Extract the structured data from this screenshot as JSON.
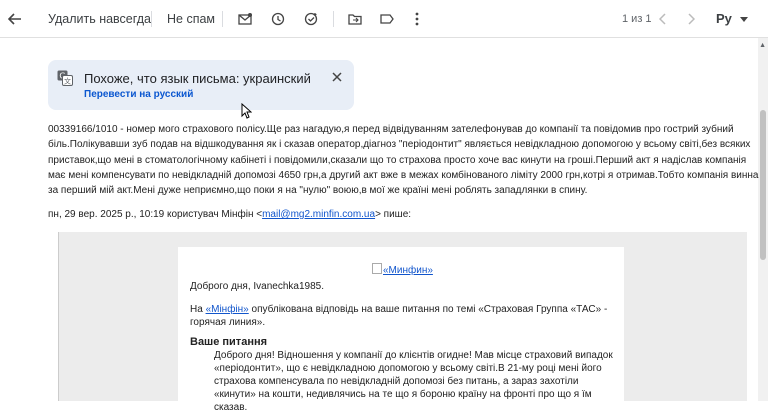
{
  "toolbar": {
    "back_icon": "arrow-left-icon",
    "delete_forever": "Удалить навсегда",
    "not_spam": "Не спам",
    "icons": [
      "mark-unread-icon",
      "snooze-icon",
      "add-task-icon",
      "move-to-icon",
      "label-icon",
      "more-vert-icon"
    ],
    "count": "1 из 1",
    "input_tools": "Ру"
  },
  "translate": {
    "title": "Похоже, что язык письма: украинский",
    "action": "Перевести на русский"
  },
  "message": {
    "body": "00339166/1010 - номер мого страхового полісу.Ще раз нагадую,я перед відвідуванням зателефонував до компанії та повідомив про гострий зубний біль.Полікувавши зуб подав на відшкодування як і сказав оператор,діагноз \"періодонтит\" являється невідкладною допомогою у всьому світі,без всяких приставок,що мені в стоматологічному кабінеті і повідомили,сказали що то страхова просто хоче вас кинути на гроші.Перший акт я надіслав компанія має мені компенсувати по невідкладній допомозі 4650 грн,а другий акт вже в межах комбінованого ліміту 2000 грн,котрі я отримав.Тобто компанія винна за перший мій акт.Мені дуже неприємно,що поки я на \"нулю\" воюю,в мої же країні мені роблять западлянки в спину.",
    "quote_prefix": "пн, 29 вер. 2025 р., 10:19 користувач Мінфін <",
    "quote_email": "mail@mg2.minfin.com.ua",
    "quote_suffix": "> пише:"
  },
  "quoted": {
    "logo_alt": "«Минфин»",
    "greeting": "Доброго дня, Ivanechka1985.",
    "pub_prefix": "На ",
    "pub_link": "«Мінфін»",
    "pub_suffix": " опублікована відповідь на ваше питання по темі «Страховая Группа «ТАС» - горячая линия».",
    "question_heading": "Ваше питання",
    "question_text": "Доброго дня! Відношення у компанії до клієнтів огидне! Мав місце страховий випадок «періодонтит», що є невідкладною допомогою у всьому світі.В 21-му році мені його страхова компенсувала по невідкладній допомозі без питань, а зараз захотіли «кинути» на кошти, недивлячись на те що я бороню країну на фронті про що я їм сказав."
  },
  "colors": {
    "accent": "#0b57d0",
    "link": "#1155cc",
    "translate_bg": "#e8eef7",
    "quoted_bg": "#ececec"
  }
}
